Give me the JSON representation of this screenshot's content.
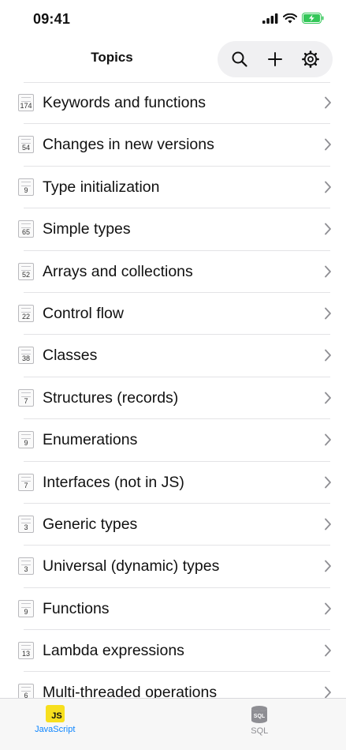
{
  "status": {
    "time": "09:41"
  },
  "header": {
    "title": "Topics"
  },
  "topics": [
    {
      "count": "174",
      "label": "Keywords and functions"
    },
    {
      "count": "54",
      "label": "Changes in new versions"
    },
    {
      "count": "9",
      "label": "Type initialization"
    },
    {
      "count": "65",
      "label": "Simple types"
    },
    {
      "count": "52",
      "label": "Arrays and collections"
    },
    {
      "count": "22",
      "label": "Control flow"
    },
    {
      "count": "38",
      "label": "Classes"
    },
    {
      "count": "7",
      "label": "Structures (records)"
    },
    {
      "count": "9",
      "label": "Enumerations"
    },
    {
      "count": "7",
      "label": "Interfaces (not in JS)"
    },
    {
      "count": "3",
      "label": "Generic types"
    },
    {
      "count": "3",
      "label": "Universal (dynamic) types"
    },
    {
      "count": "9",
      "label": "Functions"
    },
    {
      "count": "13",
      "label": "Lambda expressions"
    },
    {
      "count": "6",
      "label": "Multi-threaded operations"
    }
  ],
  "tabs": [
    {
      "label": "JavaScript",
      "icon_text": "JS",
      "active": true,
      "color": "#0a84ff"
    },
    {
      "label": "SQL",
      "icon_text": "SQL",
      "active": false,
      "color": "#8e8e93"
    }
  ],
  "colors": {
    "accent": "#0a84ff",
    "battery": "#34c759",
    "js_yellow": "#f7df1e"
  }
}
